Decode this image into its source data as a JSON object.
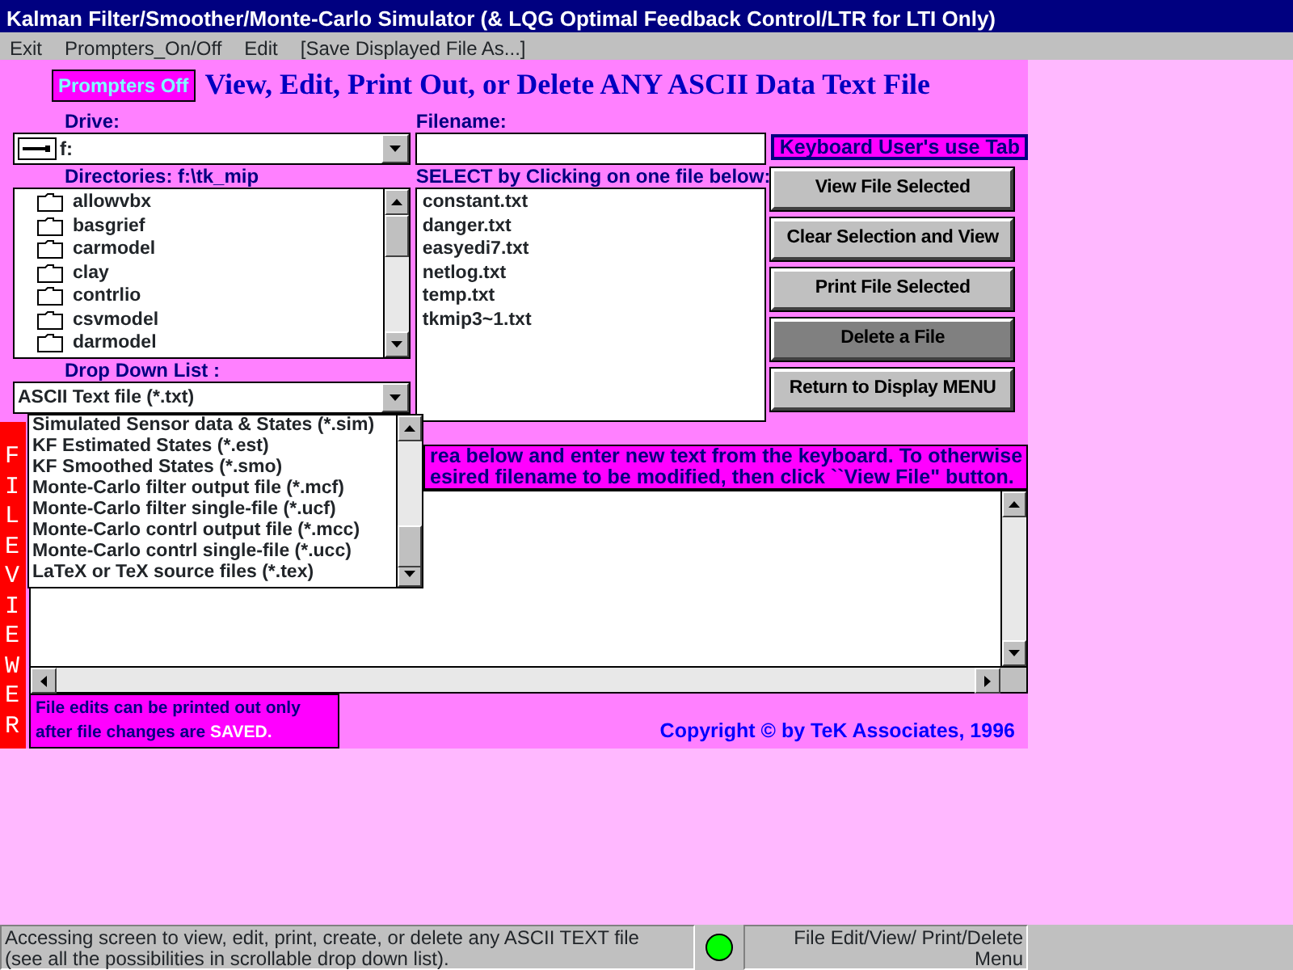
{
  "window": {
    "title": "Kalman Filter/Smoother/Monte-Carlo Simulator (& LQG Optimal Feedback Control/LTR for LTI Only)"
  },
  "menu": [
    {
      "label": "Exit"
    },
    {
      "label": "Prompters_On/Off"
    },
    {
      "label": "Edit"
    },
    {
      "label": "[Save Displayed File As...]"
    }
  ],
  "prompters_toggle": {
    "label": "Prompters Off"
  },
  "heading": "View, Edit, Print Out, or Delete ANY ASCII Data Text File",
  "drive": {
    "label": "Drive:",
    "value": "f:"
  },
  "directories": {
    "label": "Directories: f:\\tk_mip",
    "items": [
      "allowvbx",
      "basgrief",
      "carmodel",
      "clay",
      "contrlio",
      "csvmodel",
      "darmodel"
    ]
  },
  "file_type": {
    "label": "Drop Down List :",
    "value": "ASCII Text file (*.txt)",
    "expanded": true,
    "options": [
      "Simulated Sensor data & States (*.sim)",
      "KF Estimated States (*.est)",
      "KF Smoothed States (*.smo)",
      "Monte-Carlo filter output file (*.mcf)",
      "Monte-Carlo filter single-file (*.ucf)",
      "Monte-Carlo contrl output file (*.mcc)",
      "Monte-Carlo contrl single-file (*.ucc)",
      "LaTeX or TeX source files (*.tex)"
    ]
  },
  "filename": {
    "label": "Filename:"
  },
  "files": {
    "label": "SELECT by Clicking on one file below:",
    "items": [
      "constant.txt",
      "danger.txt",
      "easyedi7.txt",
      "netlog.txt",
      "temp.txt",
      "tkmip3~1.txt"
    ]
  },
  "keyboard_hint": "Keyboard User's use Tab",
  "buttons": [
    {
      "label": "View File Selected",
      "pressed": false
    },
    {
      "label": "Clear Selection and View",
      "pressed": false
    },
    {
      "label": "Print File Selected",
      "pressed": false
    },
    {
      "label": "Delete a File",
      "pressed": true
    },
    {
      "label": "Return to Display MENU",
      "pressed": false
    }
  ],
  "instructions": [
    "rea below and enter new text from the keyboard. To otherwise",
    "esired filename to be modified, then click ``View File\" button."
  ],
  "viewer_label": "FILE VIEWER",
  "note": {
    "text": "File edits can be printed out only after  file changes are",
    "highlight": "SAVED."
  },
  "copyright": "Copyright © by TeK Associates, 1996",
  "status_bar": {
    "message": [
      "Accessing screen to view, edit, print, create, or delete any ASCII TEXT file",
      "(see all the possibilities in scrollable drop down list)."
    ],
    "screen_name": [
      "File Edit/View/ Print/Delete",
      "Menu"
    ]
  }
}
